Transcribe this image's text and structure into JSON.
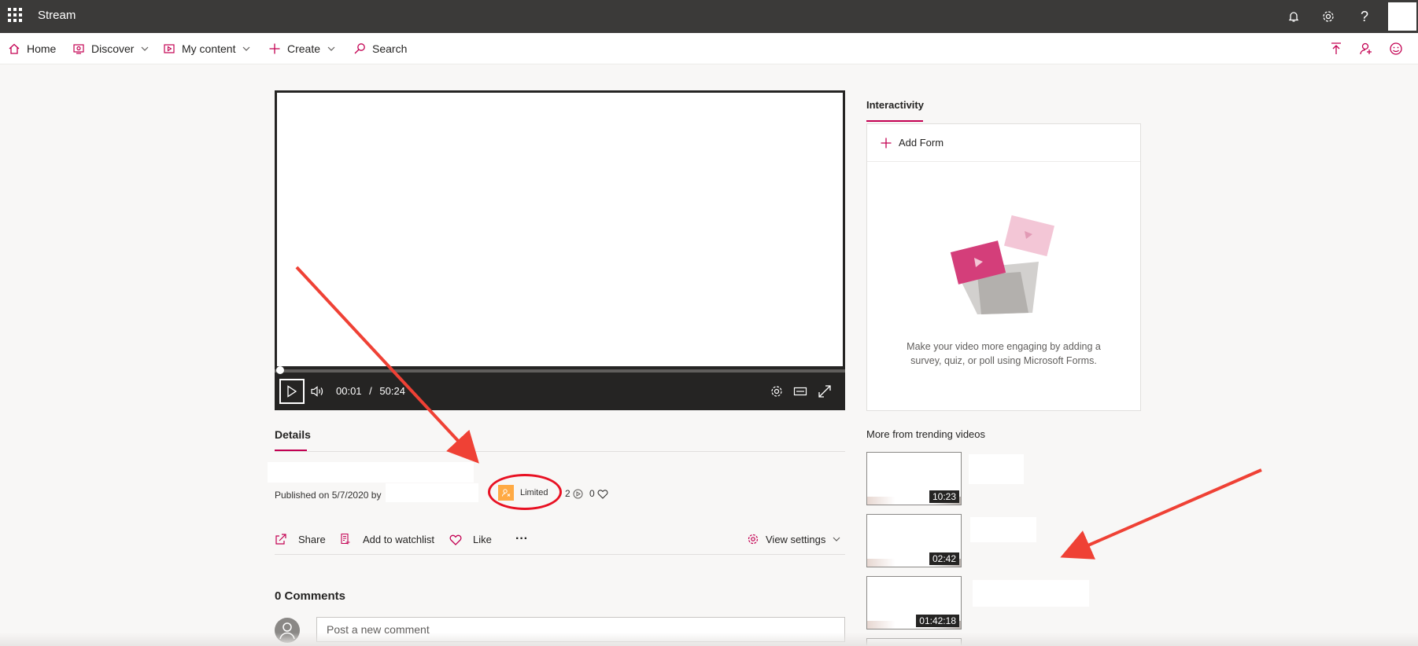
{
  "app": {
    "name": "Stream"
  },
  "nav": {
    "home": "Home",
    "discover": "Discover",
    "my_content": "My content",
    "create": "Create",
    "search": "Search"
  },
  "player": {
    "current_time": "00:01",
    "separator": "/",
    "duration": "50:24",
    "progress": 0.0003
  },
  "details": {
    "tab_label": "Details",
    "published": "Published on 5/7/2020 by",
    "privacy": "Limited",
    "views": "2",
    "likes": "0"
  },
  "actions": {
    "share": "Share",
    "watchlist": "Add to watchlist",
    "like": "Like",
    "more": "···",
    "view_settings": "View settings"
  },
  "comments": {
    "count_label": "0 Comments",
    "placeholder": "Post a new comment"
  },
  "interactivity": {
    "tab_label": "Interactivity",
    "add_form": "Add Form",
    "description": "Make your video more engaging by adding a survey, quiz, or poll using Microsoft Forms."
  },
  "trending": {
    "title": "More from trending videos",
    "videos": [
      {
        "duration": "10:23"
      },
      {
        "duration": "02:42"
      },
      {
        "duration": "01:42:18"
      }
    ]
  },
  "colors": {
    "accent": "#c30052",
    "topbar": "#3b3a39",
    "annotation": "#e81123",
    "limited_badge": "#ffaa44"
  }
}
